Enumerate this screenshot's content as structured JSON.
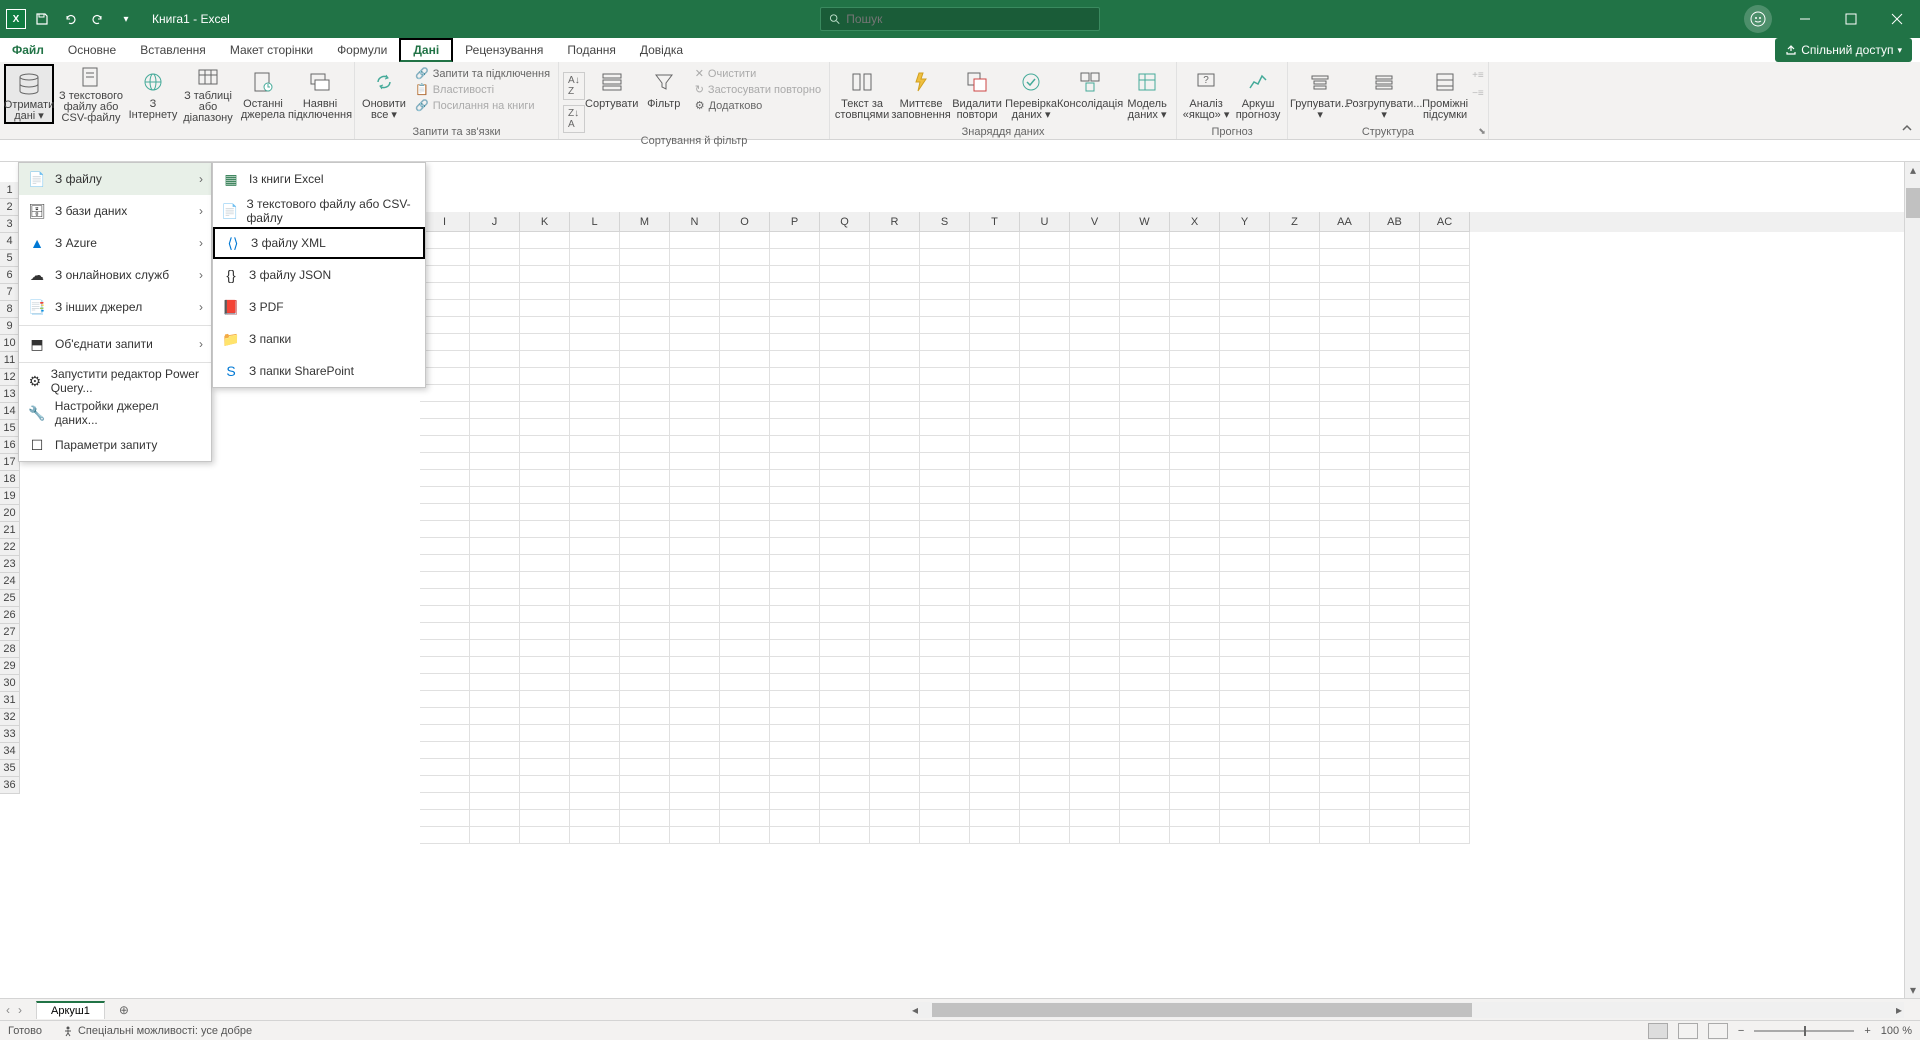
{
  "titlebar": {
    "title": "Книга1 - Excel",
    "search_placeholder": "Пошук"
  },
  "tabs": {
    "file": "Файл",
    "home": "Основне",
    "insert": "Вставлення",
    "layout": "Макет сторінки",
    "formulas": "Формули",
    "data": "Дані",
    "review": "Рецензування",
    "view": "Подання",
    "help": "Довідка",
    "share": "Спільний доступ"
  },
  "ribbon": {
    "get_data": "Отримати дані",
    "from_text_csv": "З текстового файлу або CSV-файлу",
    "from_web": "З Інтернету",
    "from_table": "З таблиці або діапазону",
    "recent_sources": "Останні джерела",
    "existing_conn": "Наявні підключення",
    "refresh_all": "Оновити все",
    "queries_conn": "Запити та підключення",
    "properties": "Властивості",
    "edit_links": "Посилання на книги",
    "group_queries": "Запити та зв'язки",
    "sort_az": "A↓Z",
    "sort_za": "Z↓A",
    "sort": "Сортувати",
    "filter": "Фільтр",
    "clear": "Очистити",
    "reapply": "Застосувати повторно",
    "advanced": "Додатково",
    "group_sort": "Сортування й фільтр",
    "text_to_cols": "Текст за стовпцями",
    "flash_fill": "Миттєве заповнення",
    "remove_dup": "Видалити повтори",
    "data_val": "Перевірка даних",
    "consolidate": "Консолідація",
    "data_model": "Модель даних",
    "group_tools": "Знаряддя даних",
    "whatif": "Аналіз «якщо»",
    "forecast": "Аркуш прогнозу",
    "group_forecast": "Прогноз",
    "group_btn": "Групувати...",
    "ungroup_btn": "Розгрупувати...",
    "subtotal": "Проміжні підсумки",
    "group_outline": "Структура"
  },
  "menu1": {
    "from_file": "З файлу",
    "from_db": "З бази даних",
    "from_azure": "З Azure",
    "from_online": "З онлайнових служб",
    "from_other": "З інших джерел",
    "combine": "Об'єднати запити",
    "pq_editor": "Запустити редактор Power Query...",
    "src_settings": "Настройки джерел даних...",
    "query_opts": "Параметри запиту"
  },
  "menu2": {
    "from_excel": "Із книги Excel",
    "from_csv": "З текстового файлу або CSV-файлу",
    "from_xml": "З файлу XML",
    "from_json": "З файлу JSON",
    "from_pdf": "З PDF",
    "from_folder": "З папки",
    "from_sp_folder": "З папки SharePoint"
  },
  "columns": [
    "I",
    "J",
    "K",
    "L",
    "M",
    "N",
    "O",
    "P",
    "Q",
    "R",
    "S",
    "T",
    "U",
    "V",
    "W",
    "X",
    "Y",
    "Z",
    "AA",
    "AB",
    "AC"
  ],
  "rows": [
    "1",
    "2",
    "3",
    "4",
    "5",
    "6",
    "7",
    "8",
    "9",
    "10",
    "11",
    "12",
    "13",
    "14",
    "15",
    "16",
    "17",
    "18",
    "19",
    "20",
    "21",
    "22",
    "23",
    "24",
    "25",
    "26",
    "27",
    "28",
    "29",
    "30",
    "31",
    "32",
    "33",
    "34",
    "35",
    "36"
  ],
  "sheet": {
    "name": "Аркуш1"
  },
  "status": {
    "ready": "Готово",
    "accessibility": "Спеціальні можливості: усе добре",
    "zoom": "100 %"
  }
}
